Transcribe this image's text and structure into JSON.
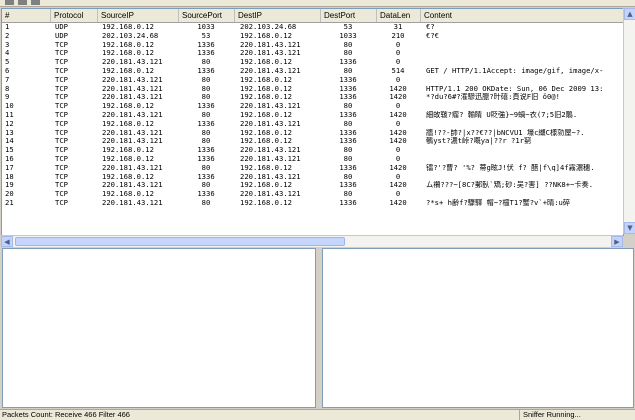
{
  "columns": [
    "#",
    "Protocol",
    "SourceIP",
    "SourcePort",
    "DestIP",
    "DestPort",
    "DataLen",
    "Content"
  ],
  "packets": [
    {
      "no": "1",
      "protocol": "UDP",
      "source_ip": "192.168.0.12",
      "source_port": "1033",
      "dest_ip": "202.103.24.68",
      "dest_port": "53",
      "data_len": "31",
      "content": "€?"
    },
    {
      "no": "2",
      "protocol": "UDP",
      "source_ip": "202.103.24.68",
      "source_port": "53",
      "dest_ip": "192.168.0.12",
      "dest_port": "1033",
      "data_len": "210",
      "content": "€?€"
    },
    {
      "no": "3",
      "protocol": "TCP",
      "source_ip": "192.168.0.12",
      "source_port": "1336",
      "dest_ip": "220.181.43.121",
      "dest_port": "80",
      "data_len": "0",
      "content": ""
    },
    {
      "no": "4",
      "protocol": "TCP",
      "source_ip": "192.168.0.12",
      "source_port": "1336",
      "dest_ip": "220.181.43.121",
      "dest_port": "80",
      "data_len": "0",
      "content": ""
    },
    {
      "no": "5",
      "protocol": "TCP",
      "source_ip": "220.181.43.121",
      "source_port": "80",
      "dest_ip": "192.168.0.12",
      "dest_port": "1336",
      "data_len": "0",
      "content": ""
    },
    {
      "no": "6",
      "protocol": "TCP",
      "source_ip": "192.168.0.12",
      "source_port": "1336",
      "dest_ip": "220.181.43.121",
      "dest_port": "80",
      "data_len": "514",
      "content": "GET / HTTP/1.1Accept: image/gif, image/x-"
    },
    {
      "no": "7",
      "protocol": "TCP",
      "source_ip": "220.181.43.121",
      "source_port": "80",
      "dest_ip": "192.168.0.12",
      "dest_port": "1336",
      "data_len": "0",
      "content": ""
    },
    {
      "no": "8",
      "protocol": "TCP",
      "source_ip": "220.181.43.121",
      "source_port": "80",
      "dest_ip": "192.168.0.12",
      "dest_port": "1336",
      "data_len": "1420",
      "content": "HTTP/1.1 200 OKDate: Sun, 06 Dec 2009 13:"
    },
    {
      "no": "9",
      "protocol": "TCP",
      "source_ip": "220.181.43.121",
      "source_port": "80",
      "dest_ip": "192.168.0.12",
      "dest_port": "1336",
      "data_len": "1420",
      "content": "*?du?6#?潅驂迅脤?旪礂:頁说F旧   ǒ0@!"
    },
    {
      "no": "10",
      "protocol": "TCP",
      "source_ip": "192.168.0.12",
      "source_port": "1336",
      "dest_ip": "220.181.43.121",
      "dest_port": "80",
      "data_len": "0",
      "content": ""
    },
    {
      "no": "11",
      "protocol": "TCP",
      "source_ip": "220.181.43.121",
      "source_port": "80",
      "dest_ip": "192.168.0.12",
      "dest_port": "1336",
      "data_len": "1420",
      "content": "  細敀皲?瘤? 輸睛  U貶強}~9蝸~衣(7;5旧2鵰."
    },
    {
      "no": "12",
      "protocol": "TCP",
      "source_ip": "192.168.0.12",
      "source_port": "1336",
      "dest_ip": "220.181.43.121",
      "dest_port": "80",
      "data_len": "0",
      "content": ""
    },
    {
      "no": "13",
      "protocol": "TCP",
      "source_ip": "220.181.43.121",
      "source_port": "80",
      "dest_ip": "192.168.0.12",
      "dest_port": "1336",
      "data_len": "1420",
      "content": "牆!??-帥?|x??€??|bNCVU1  壕c纈C様勍屋~?."
    },
    {
      "no": "14",
      "protocol": "TCP",
      "source_ip": "220.181.43.121",
      "source_port": "80",
      "dest_ip": "192.168.0.12",
      "dest_port": "1336",
      "data_len": "1420",
      "content": "鵪yst?濃t峠?嘅ya|??r    ?1r窮"
    },
    {
      "no": "15",
      "protocol": "TCP",
      "source_ip": "192.168.0.12",
      "source_port": "1336",
      "dest_ip": "220.181.43.121",
      "dest_port": "80",
      "data_len": "0",
      "content": ""
    },
    {
      "no": "16",
      "protocol": "TCP",
      "source_ip": "192.168.0.12",
      "source_port": "1336",
      "dest_ip": "220.181.43.121",
      "dest_port": "80",
      "data_len": "0",
      "content": ""
    },
    {
      "no": "17",
      "protocol": "TCP",
      "source_ip": "220.181.43.121",
      "source_port": "80",
      "dest_ip": "192.168.0.12",
      "dest_port": "1336",
      "data_len": "1420",
      "content": "镭?'?曹? '%?  蒂g眩J!伏   f?   醋|f\\q]4f霧濃穗."
    },
    {
      "no": "18",
      "protocol": "TCP",
      "source_ip": "192.168.0.12",
      "source_port": "1336",
      "dest_ip": "220.181.43.121",
      "dest_port": "80",
      "data_len": "0",
      "content": ""
    },
    {
      "no": "19",
      "protocol": "TCP",
      "source_ip": "220.181.43.121",
      "source_port": "80",
      "dest_ip": "192.168.0.12",
      "dest_port": "1336",
      "data_len": "1420",
      "content": "ム襸???~[8C?郵臥`矯;砂:吴?害]  ??NK8+~卡奏."
    },
    {
      "no": "20",
      "protocol": "TCP",
      "source_ip": "192.168.0.12",
      "source_port": "1336",
      "dest_ip": "220.181.43.121",
      "dest_port": "80",
      "data_len": "0",
      "content": ""
    },
    {
      "no": "21",
      "protocol": "TCP",
      "source_ip": "220.181.43.121",
      "source_port": "80",
      "dest_ip": "192.168.0.12",
      "dest_port": "1336",
      "data_len": "1420",
      "content": "?*s+ h齢f?驟驛 帽~?橿T1?蟹?v`+晴:u碎"
    }
  ],
  "scrollbar": {
    "up": "▲",
    "down": "▼",
    "left": "◀",
    "right": "▶"
  },
  "status": {
    "packets_count": "Packets Count: Receive 466  Filter 466",
    "state": "Sniffer Running..."
  }
}
